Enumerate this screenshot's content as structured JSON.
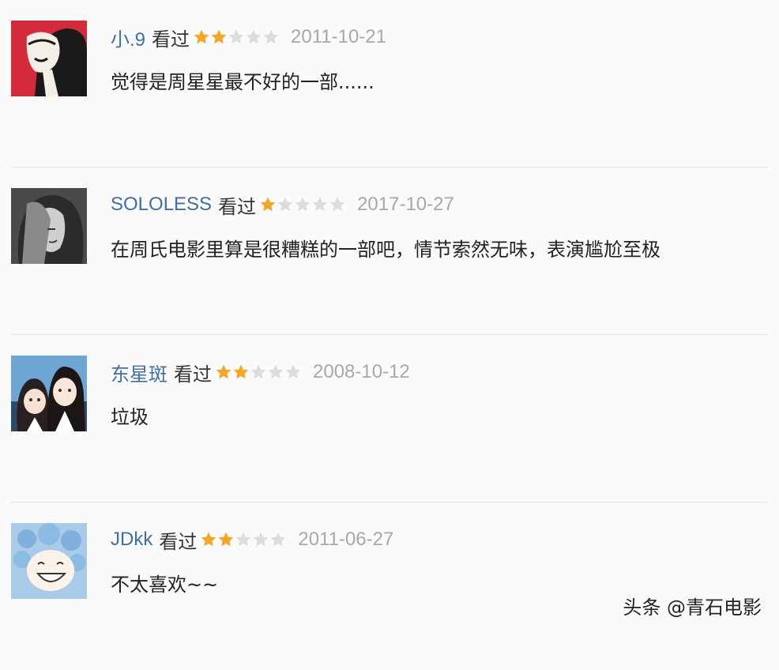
{
  "colors": {
    "username": "#3d6fa8",
    "star_on": "#f5a623",
    "star_off": "#dcdcdc",
    "date": "#a8a8a8"
  },
  "reviews": [
    {
      "username": "小.9",
      "status": "看过",
      "rating": 2,
      "max_rating": 5,
      "date": "2011-10-21",
      "comment": "觉得是周星星最不好的一部......"
    },
    {
      "username": "SOLOLESS",
      "status": "看过",
      "rating": 1,
      "max_rating": 5,
      "date": "2017-10-27",
      "comment": "在周氏电影里算是很糟糕的一部吧，情节索然无味，表演尴尬至极"
    },
    {
      "username": "东星斑",
      "status": "看过",
      "rating": 2,
      "max_rating": 5,
      "date": "2008-10-12",
      "comment": "垃圾"
    },
    {
      "username": "JDkk",
      "status": "看过",
      "rating": 2,
      "max_rating": 5,
      "date": "2011-06-27",
      "comment": "不太喜欢~~"
    }
  ],
  "watermark": "头条 @青石电影"
}
